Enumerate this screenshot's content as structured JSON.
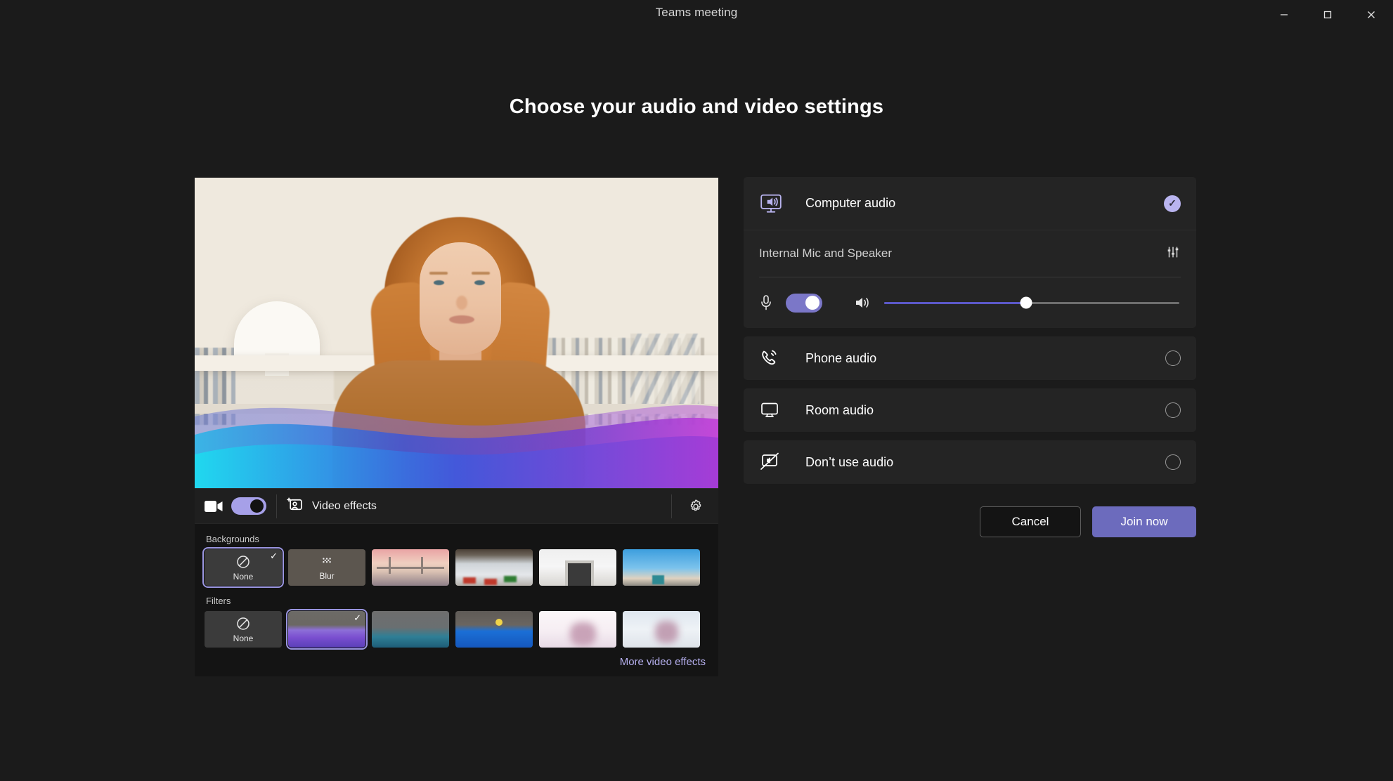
{
  "window": {
    "title": "Teams meeting",
    "controls": [
      {
        "name": "minimize",
        "glyph": "—"
      },
      {
        "name": "maximize",
        "glyph": "□"
      },
      {
        "name": "close",
        "glyph": "✕"
      }
    ]
  },
  "page": {
    "heading": "Choose your audio and video settings"
  },
  "video": {
    "toggle_on": true,
    "effects_label": "Video effects",
    "settings_icon": "gear-icon",
    "camera_icon": "camera-icon",
    "effects_icon": "video-effects-icon"
  },
  "effects": {
    "backgrounds_label": "Backgrounds",
    "filters_label": "Filters",
    "more_link": "More video effects",
    "backgrounds": [
      {
        "label": "None",
        "kind": "none",
        "selected": true
      },
      {
        "label": "Blur",
        "kind": "blur",
        "selected": false
      },
      {
        "label": "",
        "kind": "bridge",
        "selected": false
      },
      {
        "label": "",
        "kind": "office",
        "selected": false
      },
      {
        "label": "",
        "kind": "room",
        "selected": false
      },
      {
        "label": "",
        "kind": "city",
        "selected": false
      }
    ],
    "filters": [
      {
        "label": "None",
        "kind": "none",
        "selected": false
      },
      {
        "label": "",
        "kind": "purple-wave",
        "selected": true
      },
      {
        "label": "",
        "kind": "teal-wave",
        "selected": false
      },
      {
        "label": "",
        "kind": "blue-bird",
        "selected": false
      },
      {
        "label": "",
        "kind": "sakura-light",
        "selected": false
      },
      {
        "label": "",
        "kind": "sakura-blue",
        "selected": false
      }
    ]
  },
  "audio": {
    "computer": {
      "label": "Computer audio",
      "icon": "computer-audio-icon",
      "selected": true,
      "check_glyph": "✓",
      "device_name": "Internal Mic and Speaker",
      "device_settings_icon": "equalizer-icon",
      "mic_icon": "microphone-icon",
      "mic_toggle_on": true,
      "speaker_icon": "speaker-icon",
      "volume_percent": 48
    },
    "options": [
      {
        "label": "Phone audio",
        "icon": "phone-audio-icon",
        "selected": false
      },
      {
        "label": "Room audio",
        "icon": "room-audio-icon",
        "selected": false
      },
      {
        "label": "Don’t use audio",
        "icon": "no-audio-icon",
        "selected": false
      }
    ]
  },
  "actions": {
    "cancel_label": "Cancel",
    "join_label": "Join now"
  },
  "colors": {
    "accent": "#6c6bbd",
    "accent_light": "#b9b4ef",
    "toggle_on": "#7b77c8",
    "page_bg": "#1b1b1b",
    "card_bg": "#242424"
  }
}
